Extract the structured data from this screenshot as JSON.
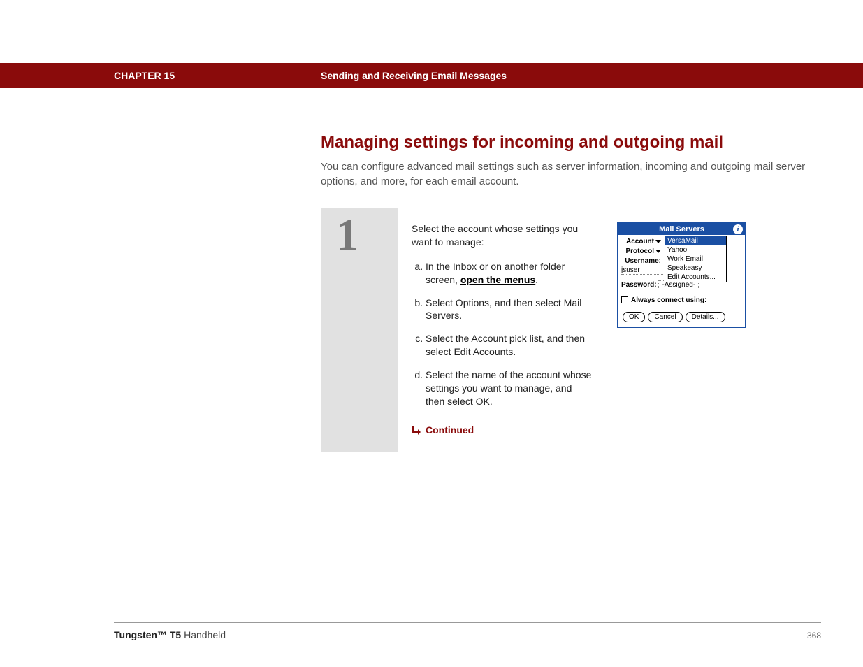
{
  "header": {
    "chapter": "CHAPTER 15",
    "title": "Sending and Receiving Email Messages"
  },
  "section": {
    "title": "Managing settings for incoming and outgoing mail",
    "subtitle": "You can configure advanced mail settings such as server information, incoming and outgoing mail server options, and more, for each email account."
  },
  "step": {
    "number": "1",
    "lead": "Select the account whose settings you want to manage:",
    "items": {
      "a_prefix": "In the Inbox or on another folder screen, ",
      "a_link": "open the menus",
      "a_suffix": ".",
      "b": "Select Options, and then select Mail Servers.",
      "c": "Select the Account pick list, and then select Edit Accounts.",
      "d": "Select the name of the account whose settings you want to manage, and then select OK."
    },
    "continued": "Continued"
  },
  "palm": {
    "title": "Mail Servers",
    "info": "i",
    "labels": {
      "account": "Account",
      "protocol": "Protocol",
      "username": "Username:",
      "password": "Password:",
      "always": "Always connect using:"
    },
    "account_selected": "VersaMail",
    "menu": [
      "VersaMail",
      "Yahoo",
      "Work Email",
      "Speakeasy",
      "Edit Accounts..."
    ],
    "username_value": "jsuser",
    "password_value": "-Assigned-",
    "buttons": {
      "ok": "OK",
      "cancel": "Cancel",
      "details": "Details..."
    }
  },
  "footer": {
    "brand_bold": "Tungsten™ T5",
    "brand_rest": " Handheld",
    "page": "368"
  }
}
